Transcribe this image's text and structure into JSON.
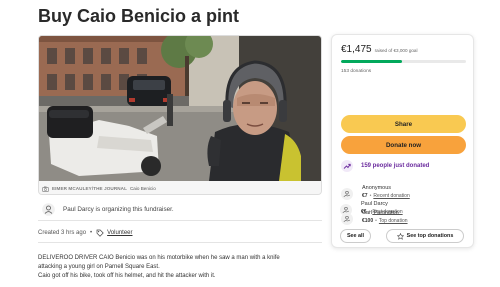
{
  "page": {
    "title": "Buy Caio Benicio a pint"
  },
  "hero": {
    "photo_alt": "Photo of man wearing a motorbike helmet",
    "caption_credit": "EIMER MCAULEY/THE JOURNAL",
    "caption_text": "Caio Benicio"
  },
  "organizer": {
    "text": "Paul Darcy is organizing this fundraiser."
  },
  "meta": {
    "created": "Created 3 hrs ago",
    "separator": "•",
    "category": "Volunteer"
  },
  "story": {
    "lines": [
      "DELIVEROO DRIVER CAIO Benicio was on his motorbike when he saw a man with a knife",
      "attacking a young girl on Parnell Square East.",
      "Caio got off his bike, took off his helmet, and hit the attacker with it."
    ]
  },
  "donation_card": {
    "raised": "€1,475",
    "goal_text": "raised of €3,000 goal",
    "progress_fraction": 0.49,
    "donations_count": "153 donations",
    "share_label": "Share",
    "donate_label": "Donate now",
    "trend_text": "159 people just donated",
    "donors": [
      {
        "name": "Anonymous",
        "amount": "€7",
        "tag": "Recent donation"
      },
      {
        "name": "Carl Partington",
        "amount": "€100",
        "tag": "Top donation"
      },
      {
        "name": "Paul Darcy",
        "amount": "€6",
        "tag": "First donation"
      }
    ],
    "see_all_label": "See all",
    "see_top_label": "See top donations",
    "donor_separator": "•"
  },
  "colors": {
    "progress_green": "#02a95c",
    "share_yellow": "#f9c951",
    "donate_orange": "#f8a23c",
    "trend_purple": "#6b2b9e"
  },
  "icons": {
    "camera": "camera-icon",
    "person": "person-icon",
    "tag": "tag-icon",
    "trend": "trending-icon",
    "donor": "hand-heart-icon",
    "star": "star-icon"
  }
}
